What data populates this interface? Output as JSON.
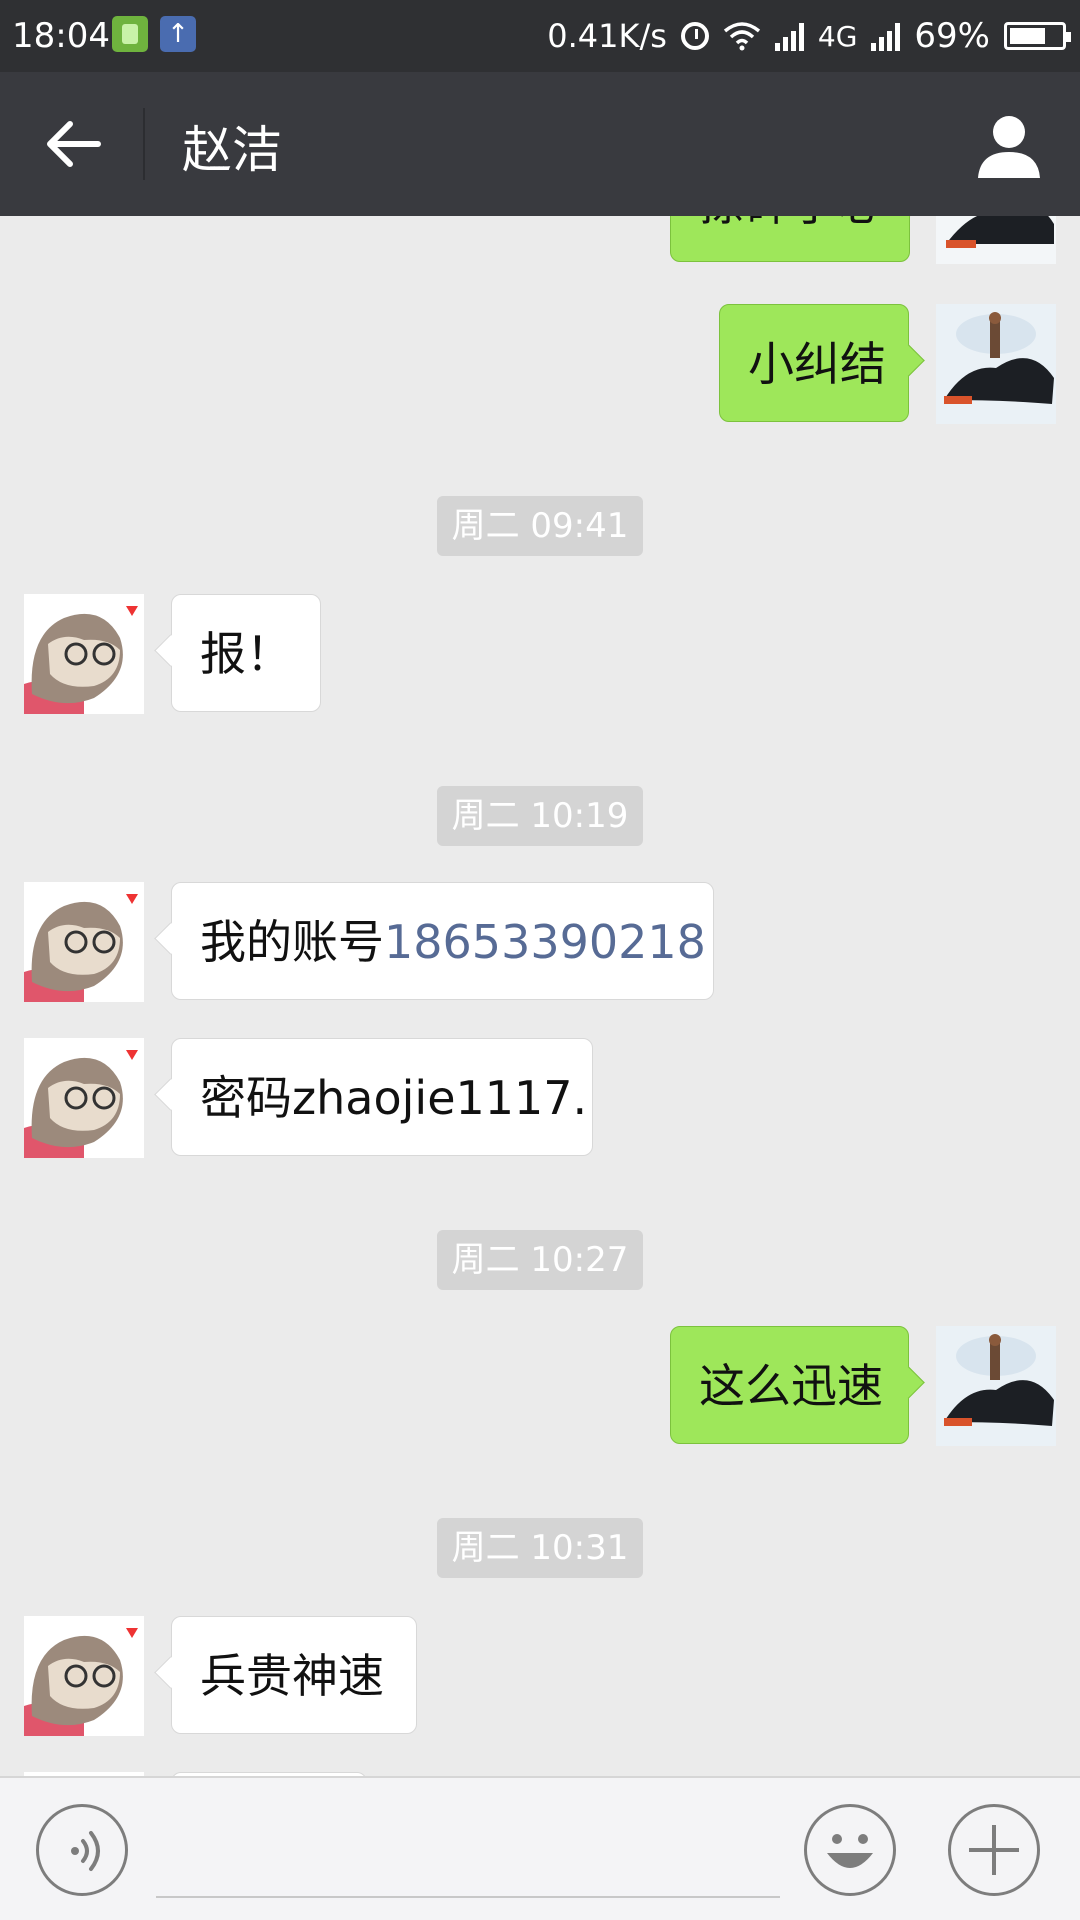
{
  "status_bar": {
    "time": "18:04",
    "upload_icon": "↑",
    "speed": "0.41K/s",
    "network": "4G",
    "battery_text": "69%",
    "battery_level": 0.69
  },
  "header": {
    "title": "赵洁"
  },
  "messages": {
    "m0": {
      "text": "搽碎了心"
    },
    "m1": {
      "text": "小纠结"
    },
    "t1": {
      "text": "周二 09:41"
    },
    "m2": {
      "text": "报！"
    },
    "t2": {
      "text": "周二 10:19"
    },
    "m3": {
      "prefix": "我的账号",
      "link": "18653390218"
    },
    "m4": {
      "text": "密码zhaojie1117."
    },
    "t3": {
      "text": "周二 10:27"
    },
    "m5": {
      "text": "这么迅速"
    },
    "t4": {
      "text": "周二 10:31"
    },
    "m6": {
      "text": "兵贵神速"
    }
  },
  "colors": {
    "outgoing_bubble": "#9ee75a",
    "incoming_bubble": "#ffffff",
    "link": "#576b95",
    "titlebar": "#393a3f"
  },
  "icons": {
    "back": "back-arrow-icon",
    "profile": "person-icon",
    "voice": "voice-icon",
    "emoji": "smiley-icon",
    "more": "plus-icon"
  }
}
